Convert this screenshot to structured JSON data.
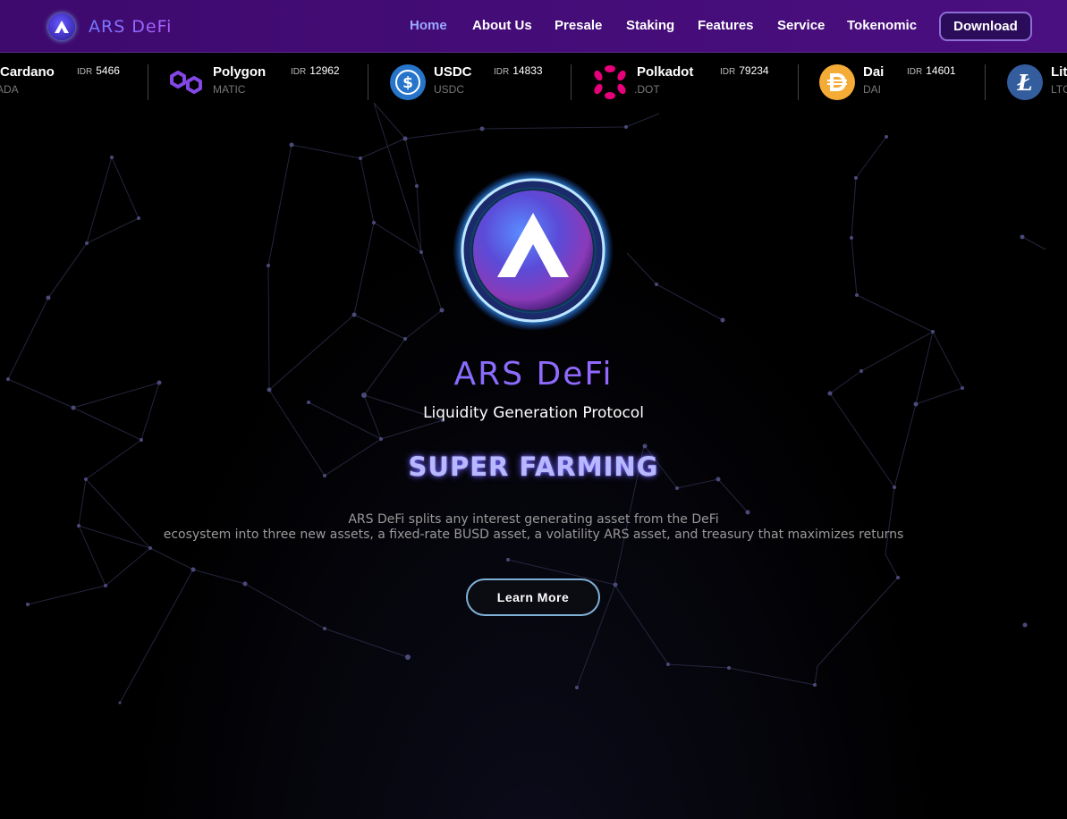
{
  "header": {
    "brand": "ARS DeFi",
    "nav": [
      "Home",
      "About Us",
      "Presale",
      "Staking",
      "Features",
      "Service",
      "Tokenomic"
    ],
    "download_label": "Download",
    "accent": "#9aa8ff"
  },
  "ticker": [
    {
      "name": "Cardano",
      "symbol": "ADA",
      "currency": "IDR",
      "price": "5466",
      "icon": "cardano-icon"
    },
    {
      "name": "Polygon",
      "symbol": "MATIC",
      "currency": "IDR",
      "price": "12962",
      "icon": "polygon-icon"
    },
    {
      "name": "USDC",
      "symbol": "USDC",
      "currency": "IDR",
      "price": "14833",
      "icon": "usdc-icon"
    },
    {
      "name": "Polkadot",
      "symbol": "DOT",
      "currency": "IDR",
      "price": "79234",
      "icon": "polkadot-icon"
    },
    {
      "name": "Dai",
      "symbol": "DAI",
      "currency": "IDR",
      "price": "14601",
      "icon": "dai-icon"
    },
    {
      "name": "Lit",
      "symbol": "LTC",
      "currency": "",
      "price": "",
      "icon": "litecoin-icon"
    }
  ],
  "hero": {
    "title": "ARS DeFi",
    "subtitle": "Liquidity Generation Protocol",
    "headline": "SUPER FARMING",
    "desc_line1": "ARS DeFi splits any interest generating asset from the DeFi",
    "desc_line2": "ecosystem into three new assets, a fixed-rate BUSD asset, a volatility ARS asset, and treasury that maximizes returns",
    "cta_label": "Learn More"
  }
}
